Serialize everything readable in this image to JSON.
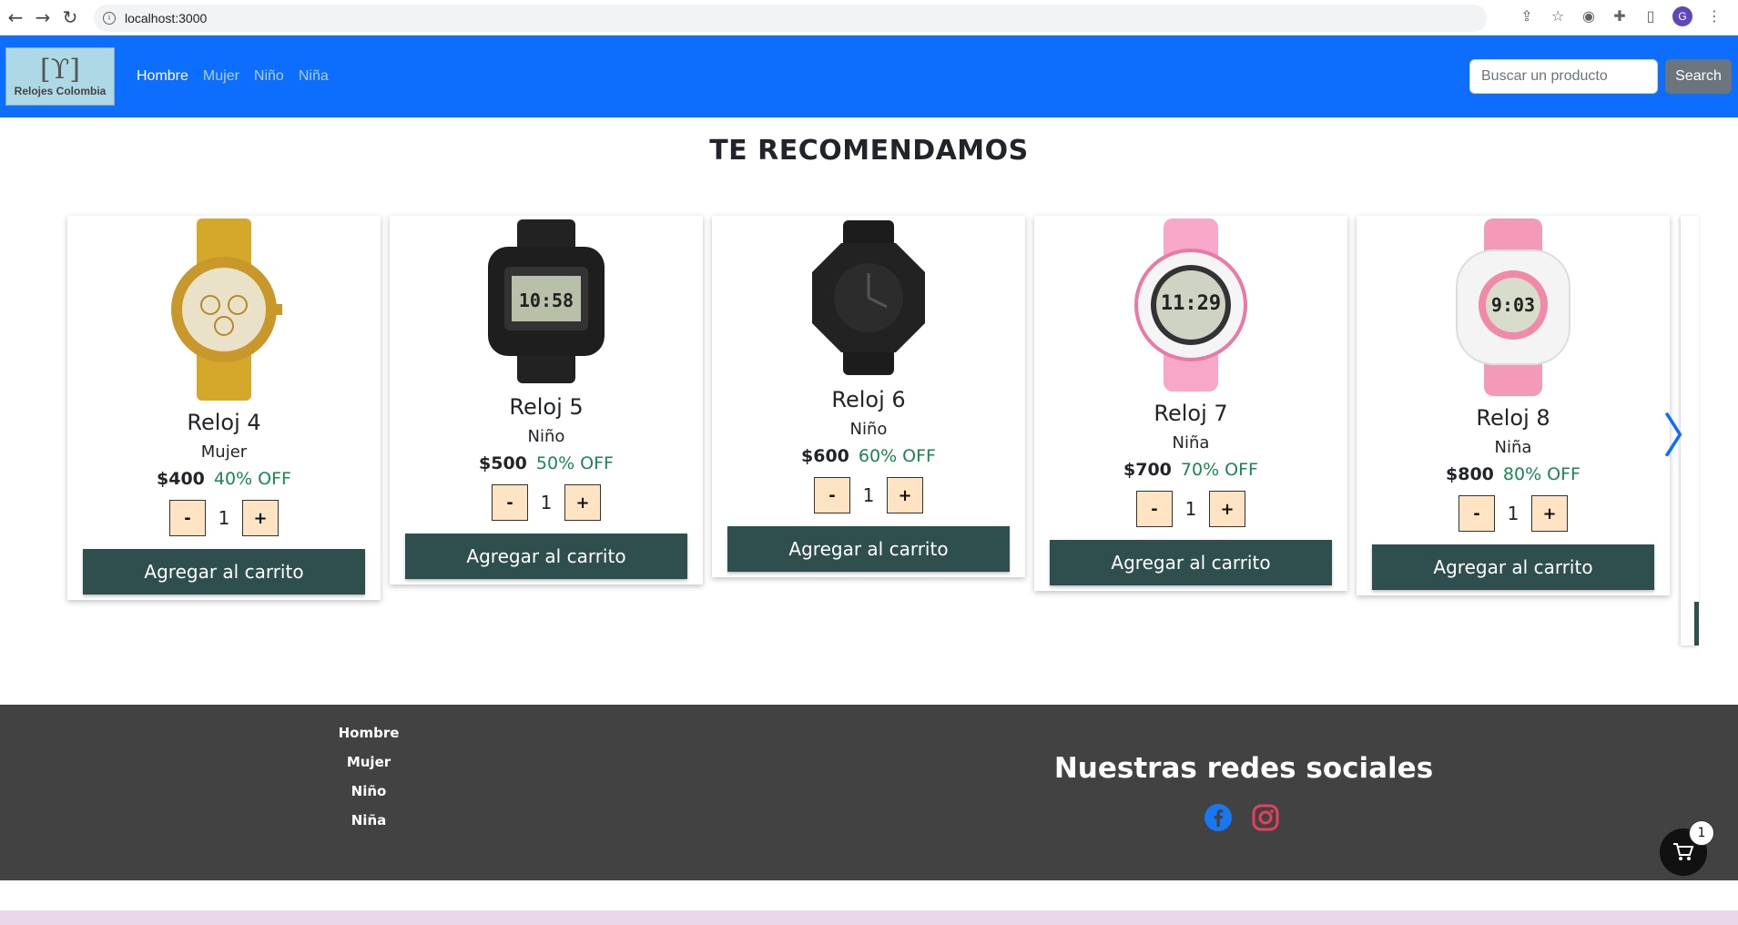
{
  "browser": {
    "back_glyph": "←",
    "forward_glyph": "→",
    "reload_glyph": "↻",
    "url": "localhost:3000",
    "profile_initial": "G"
  },
  "navbar": {
    "brand_symbol": "[ϒ]",
    "brand_name": "Relojes Colombia",
    "links": [
      {
        "label": "Hombre",
        "active": true
      },
      {
        "label": "Mujer",
        "active": false
      },
      {
        "label": "Niño",
        "active": false
      },
      {
        "label": "Niña",
        "active": false
      }
    ],
    "search_placeholder": "Buscar un producto",
    "search_button": "Search",
    "background": "#0d6efd"
  },
  "section_title": "TE RECOMENDAMOS",
  "carousel": {
    "prev_glyph": "〈",
    "next_glyph": "〉",
    "products": [
      {
        "name": "Reloj 4",
        "category": "Mujer",
        "price": "$400",
        "discount": "40% OFF",
        "quantity": "1",
        "minus": "-",
        "plus": "+",
        "add_label": "Agregar al carrito",
        "watch": "gold-chronograph"
      },
      {
        "name": "Reloj 5",
        "category": "Niño",
        "price": "$500",
        "discount": "50% OFF",
        "quantity": "1",
        "minus": "-",
        "plus": "+",
        "add_label": "Agregar al carrito",
        "watch": "black-digital"
      },
      {
        "name": "Reloj 6",
        "category": "Niño",
        "price": "$600",
        "discount": "60% OFF",
        "quantity": "1",
        "minus": "-",
        "plus": "+",
        "add_label": "Agregar al carrito",
        "watch": "black-octagon"
      },
      {
        "name": "Reloj 7",
        "category": "Niña",
        "price": "$700",
        "discount": "70% OFF",
        "quantity": "1",
        "minus": "-",
        "plus": "+",
        "add_label": "Agregar al carrito",
        "watch": "pink-digital"
      },
      {
        "name": "Reloj 8",
        "category": "Niña",
        "price": "$800",
        "discount": "80% OFF",
        "quantity": "1",
        "minus": "-",
        "plus": "+",
        "add_label": "Agregar al carrito",
        "watch": "pink-white-digital"
      }
    ]
  },
  "footer": {
    "links": [
      "Hombre",
      "Mujer",
      "Niño",
      "Niña"
    ],
    "social_title": "Nuestras redes sociales",
    "social_icons": [
      "facebook-icon",
      "instagram-icon"
    ]
  },
  "cart": {
    "count": "1"
  },
  "colors": {
    "accent": "#0d6efd",
    "add_button": "#2f4f4f",
    "discount": "#198754",
    "qty_button": "#ffe4c4",
    "footer": "#424242"
  }
}
